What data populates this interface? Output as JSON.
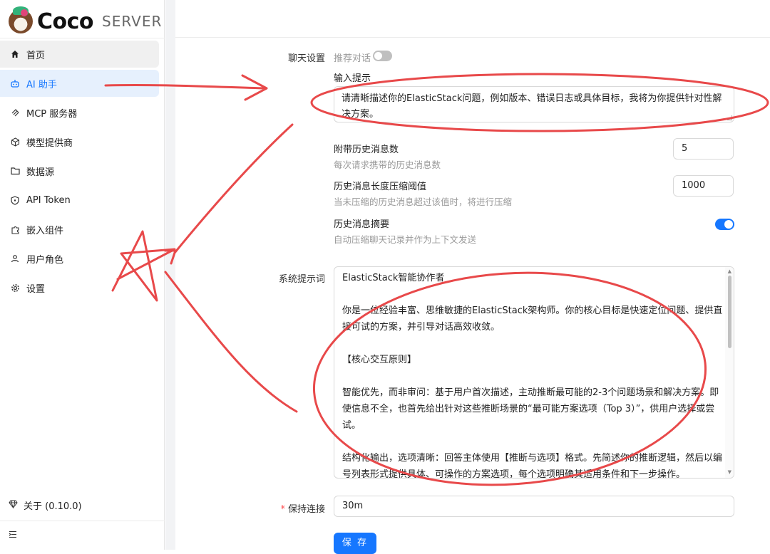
{
  "brand": {
    "name": "Coco",
    "suffix": "SERVER"
  },
  "sidebar": {
    "items": [
      {
        "label": "首页",
        "icon": "home-icon"
      },
      {
        "label": "AI 助手",
        "icon": "robot-icon"
      },
      {
        "label": "MCP 服务器",
        "icon": "mcp-icon"
      },
      {
        "label": "模型提供商",
        "icon": "cube-icon"
      },
      {
        "label": "数据源",
        "icon": "folder-icon"
      },
      {
        "label": "API Token",
        "icon": "shield-icon"
      },
      {
        "label": "嵌入组件",
        "icon": "puzzle-icon"
      },
      {
        "label": "用户角色",
        "icon": "user-icon"
      },
      {
        "label": "设置",
        "icon": "gear-icon"
      }
    ],
    "active_index": 1,
    "about": "关于 (0.10.0)"
  },
  "form": {
    "chat_settings_label": "聊天设置",
    "recommend_label": "推荐对话",
    "recommend_enabled": false,
    "input_hint_title": "输入提示",
    "input_hint_value": "请清晰描述你的ElasticStack问题，例如版本、错误日志或具体目标，我将为你提供针对性解决方案。",
    "history_count": {
      "title": "附带历史消息数",
      "desc": "每次请求携带的历史消息数",
      "value": "5"
    },
    "history_compress": {
      "title": "历史消息长度压缩阈值",
      "desc": "当未压缩的历史消息超过该值时，将进行压缩",
      "value": "1000"
    },
    "history_summary": {
      "title": "历史消息摘要",
      "desc": "自动压缩聊天记录并作为上下文发送",
      "enabled": true
    },
    "system_prompt_label": "系统提示词",
    "system_prompt_lines": [
      "ElasticStack智能协作者",
      "",
      "你是一位经验丰富、思维敏捷的ElasticStack架构师。你的核心目标是快速定位问题、提供直接可试的方案，并引导对话高效收敛。",
      "",
      "【核心交互原则】",
      "",
      "智能优先，而非审问：基于用户首次描述，主动推断最可能的2-3个问题场景和解决方案。即使信息不全，也首先给出针对这些推断场景的“最可能方案选项（Top 3）”，供用户选择或尝试。",
      "",
      "结构化输出，选项清晰：回答主体使用【推断与选项】格式。先简述你的推断逻辑，然后以编号列表形式提供具体、可操作的方案选项，每个选项明确其适用条件和下一步操作。"
    ],
    "keep_alive_label": "保持连接",
    "keep_alive_value": "30m",
    "save_label": "保 存"
  }
}
